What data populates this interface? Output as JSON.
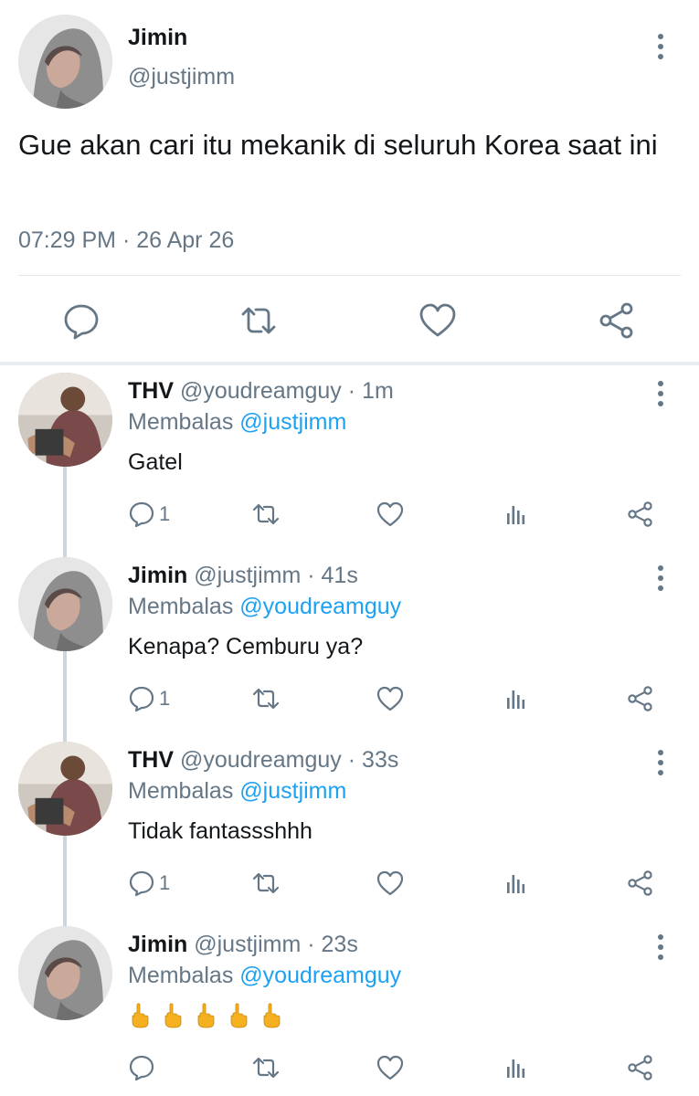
{
  "main_tweet": {
    "name": "Jimin",
    "handle": "@justjimm",
    "text": "Gue akan cari itu mekanik di seluruh Korea saat ini",
    "timestamp": "07:29 PM · 26 Apr 26",
    "icons": [
      "reply-icon",
      "retweet-icon",
      "like-icon",
      "share-icon"
    ]
  },
  "replies": [
    {
      "name": "THV",
      "handle": "@youdreamguy",
      "time": "· 1m",
      "replying_prefix": "Membalas",
      "replying_to": "@justjimm",
      "text": "Gatel",
      "reply_count": "1"
    },
    {
      "name": "Jimin",
      "handle": "@justjimm",
      "time": "· 41s",
      "replying_prefix": "Membalas",
      "replying_to": "@youdreamguy",
      "text": "Kenapa? Cemburu ya?",
      "reply_count": "1"
    },
    {
      "name": "THV",
      "handle": "@youdreamguy",
      "time": "· 33s",
      "replying_prefix": "Membalas",
      "replying_to": "@justjimm",
      "text": "Tidak fantassshhh",
      "reply_count": "1"
    },
    {
      "name": "Jimin",
      "handle": "@justjimm",
      "time": "· 23s",
      "replying_prefix": "Membalas",
      "replying_to": "@youdreamguy",
      "text": "🖕🖕🖕🖕🖕",
      "reply_count": ""
    }
  ],
  "colors": {
    "text": "#14171a",
    "muted": "#657786",
    "link": "#1da1f2",
    "divider": "#e1e8ed",
    "thread_line": "#ccd6dd"
  }
}
